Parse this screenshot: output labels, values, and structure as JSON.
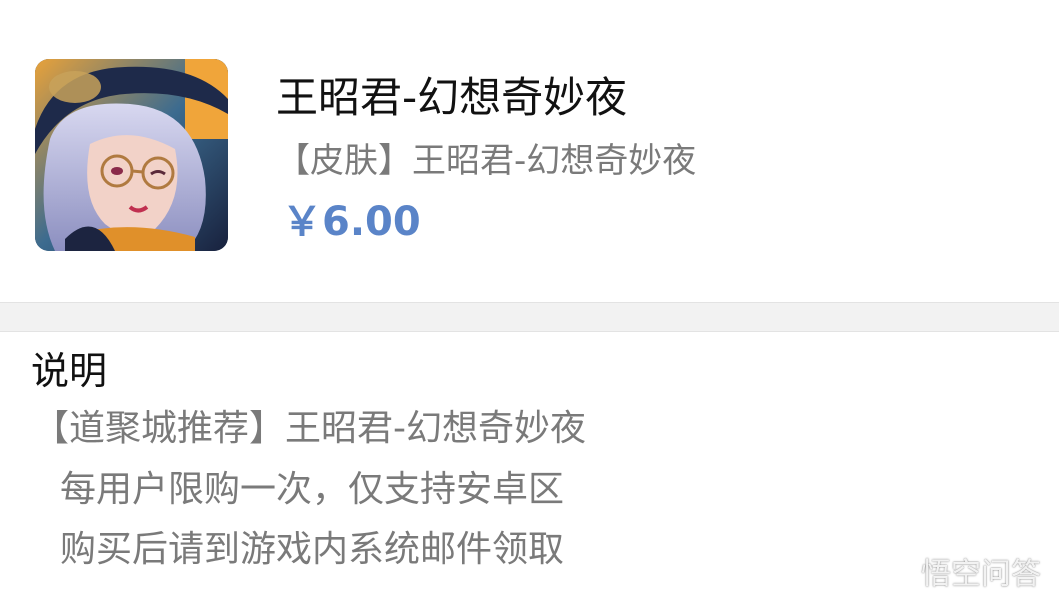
{
  "product": {
    "image_icon": "skin-portrait-icon",
    "title": "王昭君-幻想奇妙夜",
    "subtitle": "【皮肤】王昭君-幻想奇妙夜",
    "price": "￥6.00",
    "price_color": "#5a84c8"
  },
  "description": {
    "heading": "说明",
    "lines": [
      "【道聚城推荐】王昭君-幻想奇妙夜",
      "每用户限购一次，仅支持安卓区",
      "购买后请到游戏内系统邮件领取"
    ]
  },
  "watermark": {
    "icon": "wukong-logo-icon",
    "text": "悟空问答"
  }
}
